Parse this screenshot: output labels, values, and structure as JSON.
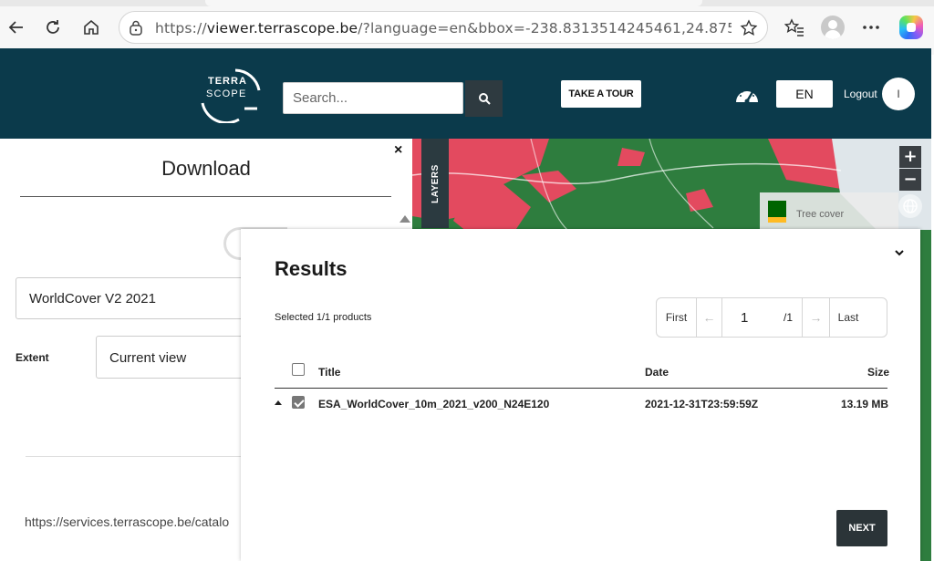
{
  "browser": {
    "url_host": "viewer.terrascope.be",
    "url_prefix": "https://",
    "url_rest": "/?language=en&bbox=-238.8313514245461,24.87549776..."
  },
  "header": {
    "logo_top": "TERRA",
    "logo_bottom": "SCOPE",
    "search_placeholder": "Search...",
    "tour_label": "TAKE A TOUR",
    "language": "EN",
    "logout_label": "Logout",
    "user_initial": "I"
  },
  "map": {
    "layers_tab": "LAYERS",
    "zoom_in": "+",
    "zoom_out": "−",
    "legend_label": "Tree cover",
    "colors": {
      "tree_cover": "#006400",
      "urban": "#e34a5f",
      "water": "#dfe6ea"
    }
  },
  "download": {
    "title": "Download",
    "close": "×",
    "product": "WorldCover V2 2021",
    "extent_label": "Extent",
    "extent_value": "Current view",
    "catalog_url": "https://services.terrascope.be/catalo"
  },
  "results": {
    "title": "Results",
    "selected": "Selected 1/1 products",
    "pager": {
      "first": "First",
      "prev": "←",
      "page": "1",
      "total": "/1",
      "next": "→",
      "last": "Last"
    },
    "columns": {
      "title": "Title",
      "date": "Date",
      "size": "Size"
    },
    "rows": [
      {
        "title": "ESA_WorldCover_10m_2021_v200_N24E120",
        "date": "2021-12-31T23:59:59Z",
        "size": "13.19 MB",
        "checked": true
      }
    ],
    "next_label": "NEXT"
  }
}
